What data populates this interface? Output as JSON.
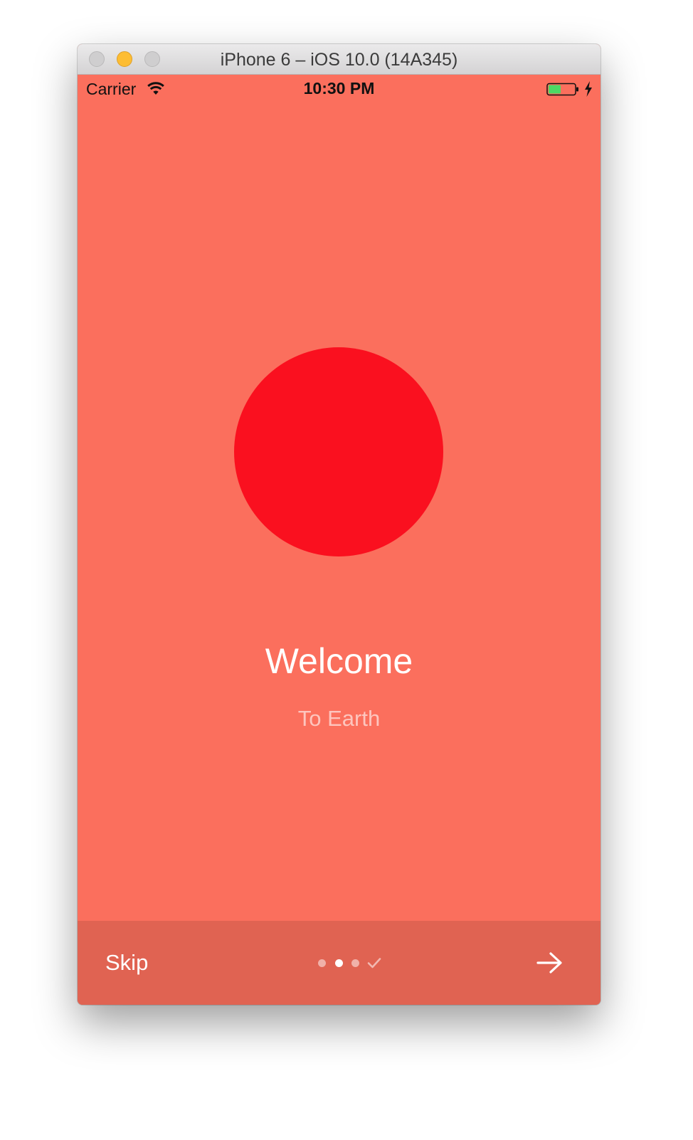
{
  "window": {
    "title": "iPhone 6 – iOS 10.0 (14A345)"
  },
  "status_bar": {
    "carrier": "Carrier",
    "time": "10:30 PM",
    "icons": [
      "wifi-icon",
      "battery-icon",
      "charging-bolt-icon"
    ]
  },
  "onboarding": {
    "title": "Welcome",
    "subtitle": "To Earth",
    "background_color": "#fb6f5d",
    "circle_color": "#fa101f"
  },
  "bottom_bar": {
    "skip_label": "Skip",
    "page_indicator": {
      "page_count": 3,
      "current_page": 2,
      "final_icon": "checkmark-icon"
    },
    "next_icon": "arrow-right-icon",
    "background_color": "#e06352"
  }
}
